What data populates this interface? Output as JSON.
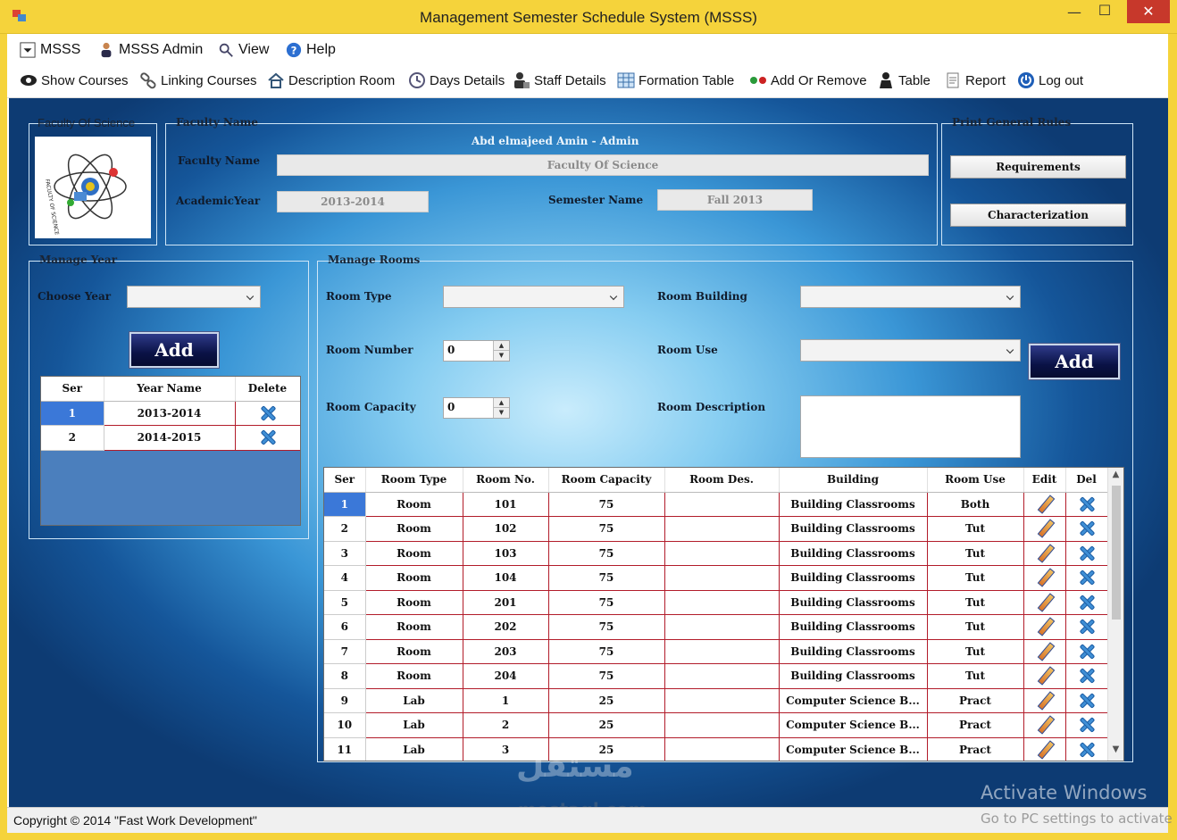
{
  "window": {
    "title": "Management Semester Schedule System (MSSS)",
    "close_glyph": "✕",
    "minimize_glyph": "—",
    "maximize_glyph": "☐"
  },
  "menu": [
    {
      "label": "MSSS",
      "icon": "dropdown-box-icon"
    },
    {
      "label": "MSSS Admin",
      "icon": "admin-user-icon"
    },
    {
      "label": "View",
      "icon": "view-magnifier-icon"
    },
    {
      "label": "Help",
      "icon": "help-icon"
    }
  ],
  "toolbar": [
    {
      "label": "Show Courses",
      "icon": "eye-icon"
    },
    {
      "label": "Linking Courses",
      "icon": "link-icon"
    },
    {
      "label": "Description Room",
      "icon": "home-icon"
    },
    {
      "label": "Days Details",
      "icon": "clock-icon"
    },
    {
      "label": "Staff Details",
      "icon": "staff-icon"
    },
    {
      "label": "Formation Table",
      "icon": "table-icon"
    },
    {
      "label": "Add Or Remove",
      "icon": "add-remove-icon"
    },
    {
      "label": "Table",
      "icon": "person-icon"
    },
    {
      "label": "Report",
      "icon": "report-icon"
    },
    {
      "label": "Log out",
      "icon": "power-icon"
    }
  ],
  "faculty_logo": {
    "group_title": "Faculty Of Science",
    "logo_text": "FACULTY OF SCIENCE"
  },
  "faculty_info": {
    "group_title": "Faculty Name",
    "user_line": "Abd elmajeed Amin - Admin",
    "faculty_name_label": "Faculty Name",
    "faculty_name_value": "Faculty Of Science",
    "academic_year_label": "AcademicYear",
    "academic_year_value": "2013-2014",
    "semester_label": "Semester Name",
    "semester_value": "Fall 2013"
  },
  "print_rules": {
    "group_title": "Print General Rules",
    "requirements_label": "Requirements",
    "characterization_label": "Characterization"
  },
  "manage_year": {
    "group_title": "Manage Year",
    "choose_year_label": "Choose Year",
    "choose_year_value": "",
    "add_label": "Add",
    "columns": [
      "Ser",
      "Year Name",
      "Delete"
    ],
    "rows": [
      {
        "ser": "1",
        "year": "2013-2014"
      },
      {
        "ser": "2",
        "year": "2014-2015"
      }
    ]
  },
  "manage_rooms": {
    "group_title": "Manage Rooms",
    "room_type_label": "Room Type",
    "room_type_value": "",
    "room_building_label": "Room Building",
    "room_building_value": "",
    "room_number_label": "Room Number",
    "room_number_value": "0",
    "room_use_label": "Room Use",
    "room_use_value": "",
    "room_capacity_label": "Room Capacity",
    "room_capacity_value": "0",
    "room_description_label": "Room Description",
    "room_description_value": "",
    "add_label": "Add",
    "columns": [
      "Ser",
      "Room Type",
      "Room No.",
      "Room Capacity",
      "Room Des.",
      "Building",
      "Room Use",
      "Edit",
      "Del"
    ],
    "rows": [
      {
        "ser": "1",
        "type": "Room",
        "no": "101",
        "cap": "75",
        "des": "",
        "building": "Building Classrooms",
        "use": "Both"
      },
      {
        "ser": "2",
        "type": "Room",
        "no": "102",
        "cap": "75",
        "des": "",
        "building": "Building Classrooms",
        "use": "Tut"
      },
      {
        "ser": "3",
        "type": "Room",
        "no": "103",
        "cap": "75",
        "des": "",
        "building": "Building Classrooms",
        "use": "Tut"
      },
      {
        "ser": "4",
        "type": "Room",
        "no": "104",
        "cap": "75",
        "des": "",
        "building": "Building Classrooms",
        "use": "Tut"
      },
      {
        "ser": "5",
        "type": "Room",
        "no": "201",
        "cap": "75",
        "des": "",
        "building": "Building Classrooms",
        "use": "Tut"
      },
      {
        "ser": "6",
        "type": "Room",
        "no": "202",
        "cap": "75",
        "des": "",
        "building": "Building Classrooms",
        "use": "Tut"
      },
      {
        "ser": "7",
        "type": "Room",
        "no": "203",
        "cap": "75",
        "des": "",
        "building": "Building Classrooms",
        "use": "Tut"
      },
      {
        "ser": "8",
        "type": "Room",
        "no": "204",
        "cap": "75",
        "des": "",
        "building": "Building Classrooms",
        "use": "Tut"
      },
      {
        "ser": "9",
        "type": "Lab",
        "no": "1",
        "cap": "25",
        "des": "",
        "building": "Computer Science B...",
        "use": "Pract"
      },
      {
        "ser": "10",
        "type": "Lab",
        "no": "2",
        "cap": "25",
        "des": "",
        "building": "Computer Science B...",
        "use": "Pract"
      },
      {
        "ser": "11",
        "type": "Lab",
        "no": "3",
        "cap": "25",
        "des": "",
        "building": "Computer Science B...",
        "use": "Pract"
      }
    ]
  },
  "statusbar": {
    "copyright": "Copyright © 2014 \"Fast Work Development\""
  },
  "overlay": {
    "activate_title": "Activate Windows",
    "activate_sub": "Go to PC settings to activate",
    "watermark_arabic": "مستقل",
    "watermark_site": "mostaql.com"
  },
  "colors": {
    "titlebar": "#f5d33b",
    "close_button": "#c7382b",
    "grid_line": "#b21c2a",
    "selected_cell": "#3b78d8",
    "dark_button": "#0a1246"
  }
}
